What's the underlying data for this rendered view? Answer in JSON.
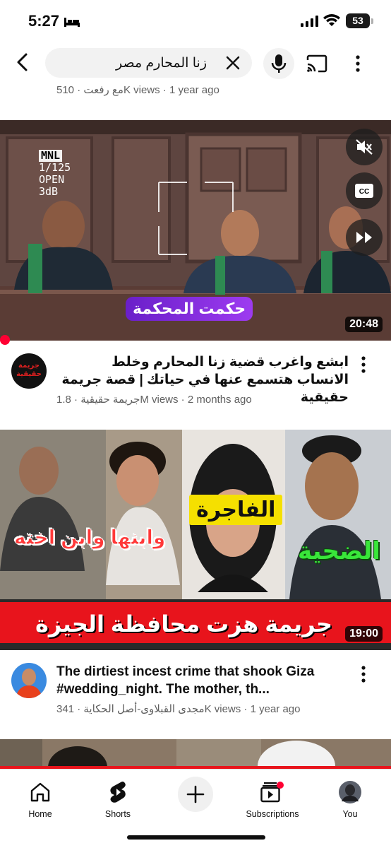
{
  "status_bar": {
    "time": "5:27",
    "battery": "53"
  },
  "search": {
    "query": "زنا المحارم مصر"
  },
  "previous_item": {
    "meta": "مع رفعت · 510K views · 1 year ago"
  },
  "videos": [
    {
      "caption": "حكمت المحكمة",
      "overlay_text": "MNL\n1/125\nOPEN\n3dB",
      "overlay_lines": [
        "MNL",
        "1/125",
        "OPEN",
        "3dB"
      ],
      "duration": "20:48",
      "channel_avatar_text": "جريمة حقيقية",
      "title": "ابشع واغرب قضية زنا المحارم وخلط الانساب هتسمع عنها في حياتك | قصة جريمة حقيقية",
      "meta": "جريمة حقيقية · 1.8M views · 2 months ago"
    },
    {
      "caption_left": "وابنها وابن اخته",
      "caption_mid": "الفاجرة",
      "caption_right": "الضحية",
      "banner": "جريمة هزت محافظة الجيزة",
      "duration": "19:00",
      "title": "The dirtiest incest crime that shook Giza #wedding_night. The mother, th...",
      "meta": "مجدى القبلاوى-أصل الحكاية · 341K views · 1 year ago"
    }
  ],
  "bottom_nav": {
    "home": "Home",
    "shorts": "Shorts",
    "subscriptions": "Subscriptions",
    "you": "You"
  },
  "colors": {
    "accent": "#ff0033",
    "caption_purple": "#7b2be0",
    "banner_red": "#e8141c"
  }
}
